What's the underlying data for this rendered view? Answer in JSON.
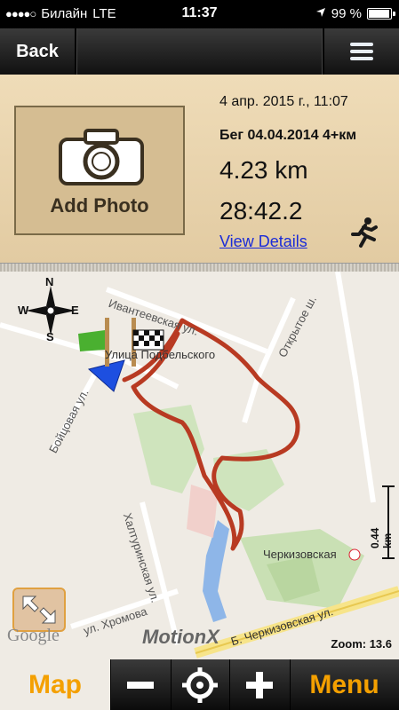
{
  "status": {
    "carrier": "Билайн",
    "network": "LTE",
    "time": "11:37",
    "battery": "99 %"
  },
  "nav": {
    "back_label": "Back"
  },
  "activity": {
    "add_photo_label": "Add Photo",
    "date": "4 апр. 2015 г., 11:07",
    "name": "Бег 04.04.2014 4+км",
    "distance": "4.23 km",
    "duration": "28:42.2",
    "view_details": "View Details"
  },
  "map": {
    "compass": {
      "n": "N",
      "s": "S",
      "e": "E",
      "w": "W"
    },
    "streets": {
      "ivanteevskaya": "Ивантеевская ул.",
      "podbelskogo": "Улица Подбельского",
      "otkrytoe": "Открытое ш.",
      "boytsovaya": "Бойцовая ул.",
      "khalturinskaya": "Халтуринская ул.",
      "khromova": "ул. Хромова",
      "cherkizovskaya_station": "Черкизовская",
      "cherkizovskaya_st": "Б. Черкизовская ул."
    },
    "scale": "0.44 km",
    "zoom": "Zoom: 13.6",
    "google": "Google",
    "brand": "MotionX"
  },
  "toolbar": {
    "map_label": "Map",
    "menu_label": "Menu"
  },
  "colors": {
    "accent": "#f4a000",
    "track": "#b83a22",
    "link": "#1a2bd8"
  }
}
